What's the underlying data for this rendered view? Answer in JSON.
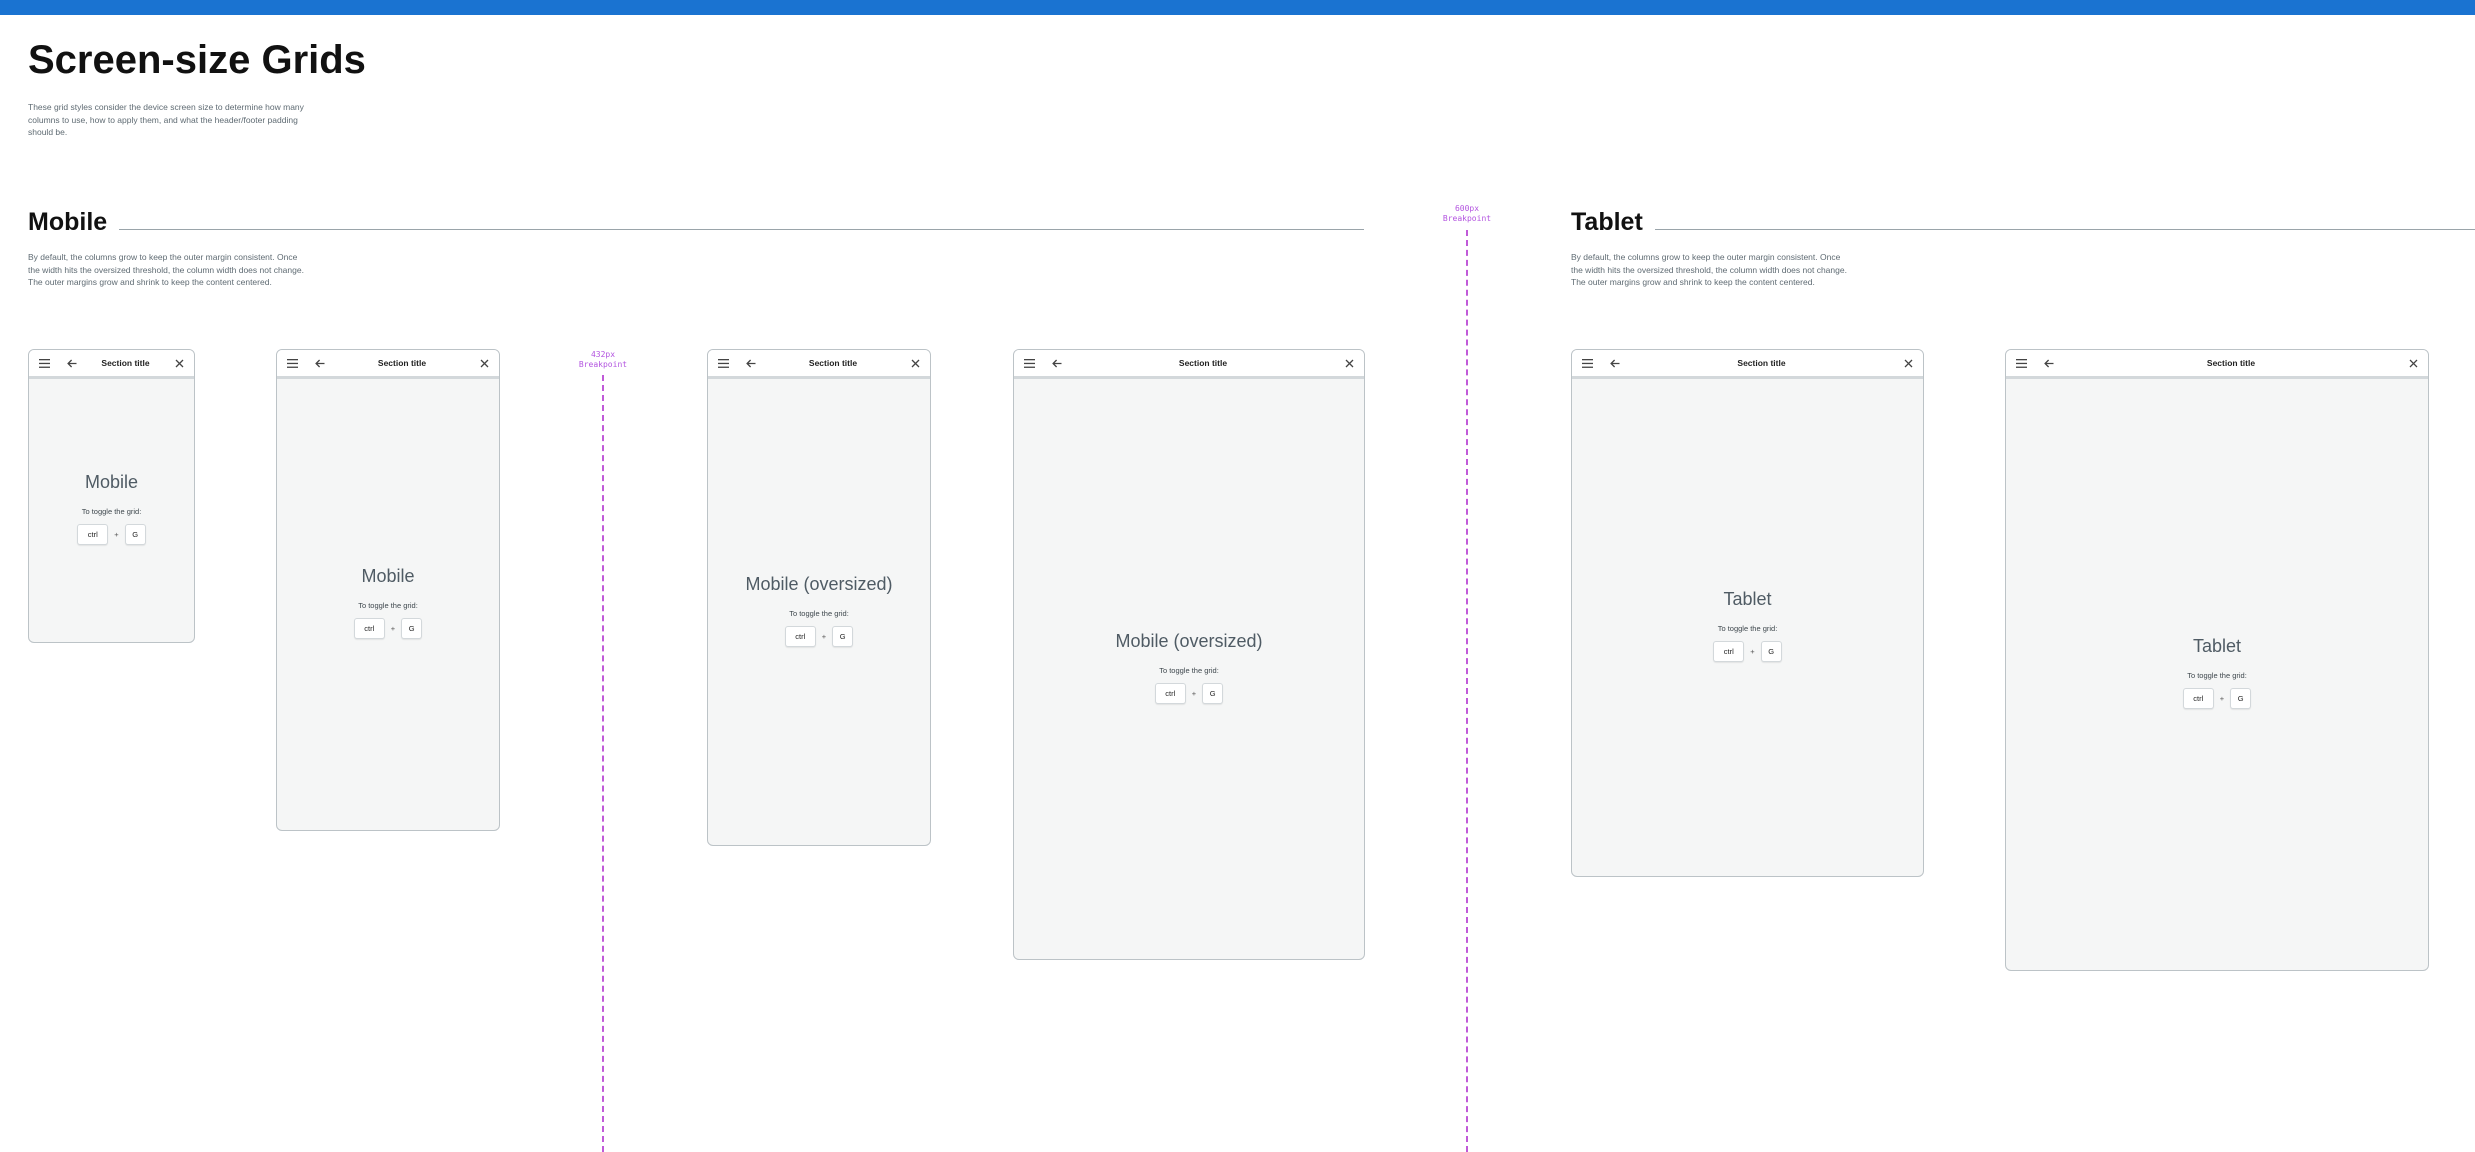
{
  "page": {
    "title": "Screen-size Grids",
    "description": "These grid styles consider the device screen size to determine how many columns to use, how to apply them, and what the header/footer padding should be."
  },
  "sections": {
    "mobile": {
      "title": "Mobile",
      "description": "By default, the columns grow to keep the outer margin consistent. Once the width hits the oversized threshold, the column width does not change. The outer margins grow and shrink to keep the content centered."
    },
    "tablet": {
      "title": "Tablet",
      "description": "By default, the columns grow to keep the outer margin consistent. Once the width hits the oversized threshold, the column width does not change. The outer margins grow and shrink to keep the content centered."
    }
  },
  "breakpoints": [
    {
      "value": "432px",
      "label": "Breakpoint"
    },
    {
      "value": "600px",
      "label": "Breakpoint"
    }
  ],
  "frames": [
    {
      "header_title": "Section title",
      "device": "Mobile",
      "toggle_text": "To toggle the grid:",
      "key_modifier": "ctrl",
      "key_plus": "+",
      "key_letter": "G"
    },
    {
      "header_title": "Section title",
      "device": "Mobile",
      "toggle_text": "To toggle the grid:",
      "key_modifier": "ctrl",
      "key_plus": "+",
      "key_letter": "G"
    },
    {
      "header_title": "Section title",
      "device": "Mobile (oversized)",
      "toggle_text": "To toggle the grid:",
      "key_modifier": "ctrl",
      "key_plus": "+",
      "key_letter": "G"
    },
    {
      "header_title": "Section title",
      "device": "Mobile (oversized)",
      "toggle_text": "To toggle the grid:",
      "key_modifier": "ctrl",
      "key_plus": "+",
      "key_letter": "G"
    },
    {
      "header_title": "Section title",
      "device": "Tablet",
      "toggle_text": "To toggle the grid:",
      "key_modifier": "ctrl",
      "key_plus": "+",
      "key_letter": "G"
    },
    {
      "header_title": "Section title",
      "device": "Tablet",
      "toggle_text": "To toggle the grid:",
      "key_modifier": "ctrl",
      "key_plus": "+",
      "key_letter": "G"
    }
  ],
  "icons": {
    "menu": "menu-icon",
    "back": "arrow-back-icon",
    "close": "close-icon"
  },
  "colors": {
    "top_bar": "#1a73d1",
    "breakpoint": "#c05ad8",
    "frame_background": "#f5f6f6"
  }
}
